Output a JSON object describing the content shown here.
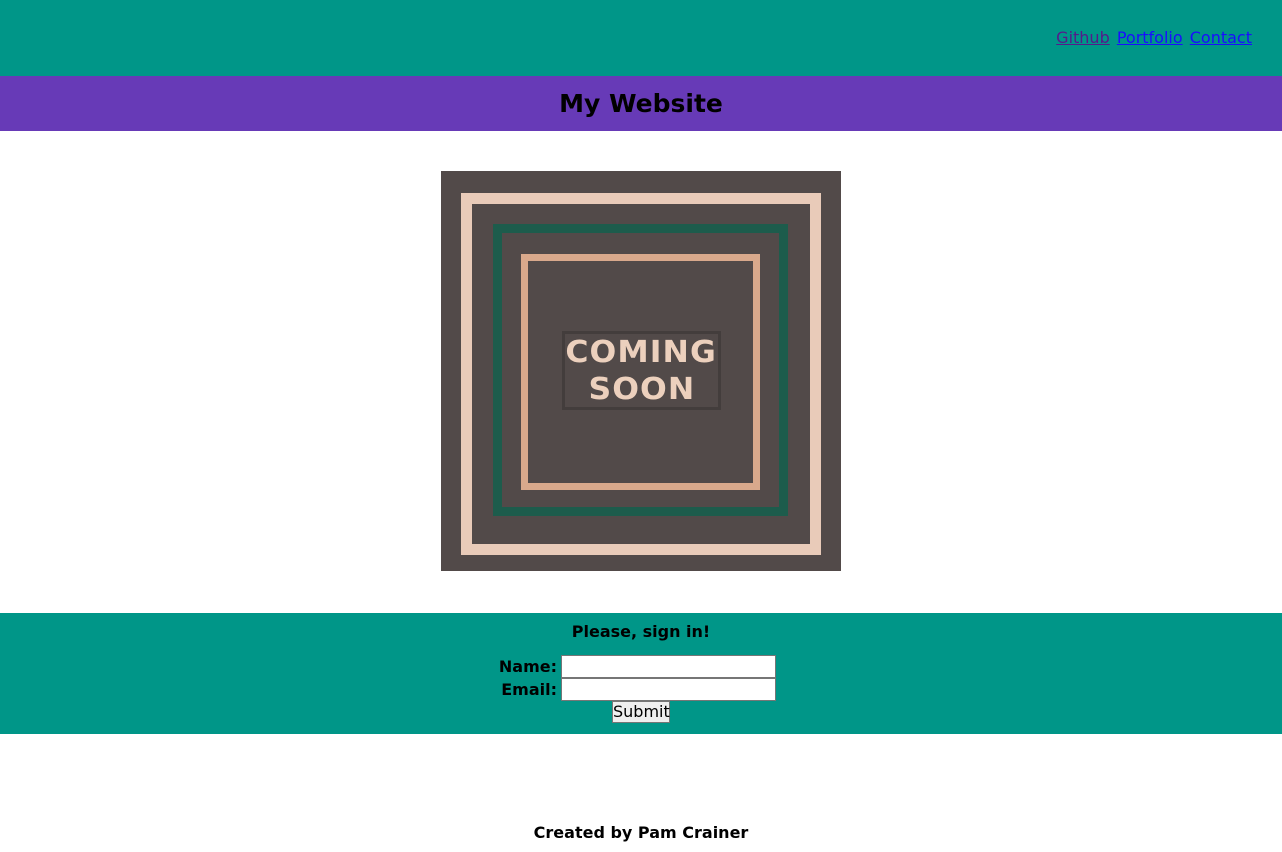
{
  "nav": {
    "links": [
      {
        "label": "Github"
      },
      {
        "label": "Portfolio"
      },
      {
        "label": "Contact"
      }
    ]
  },
  "header": {
    "title": "My Website"
  },
  "poster": {
    "line1": "COMING",
    "line2": "SOON"
  },
  "signin": {
    "title": "Please, sign in!",
    "name_label": "Name:",
    "name_value": "",
    "email_label": "Email:",
    "email_value": "",
    "submit_label": "Submit"
  },
  "footer": {
    "text": "Created by Pam Crainer"
  },
  "colors": {
    "topbar": "#009688",
    "titlebar": "#673ab7",
    "poster_bg": "#524a49",
    "poster_frame_outer": "#e9cbb9",
    "poster_frame_middle": "#1d5c4c",
    "poster_frame_inner": "#d9a98c",
    "link": "#1a0dff",
    "link_visited": "#551a8b"
  }
}
